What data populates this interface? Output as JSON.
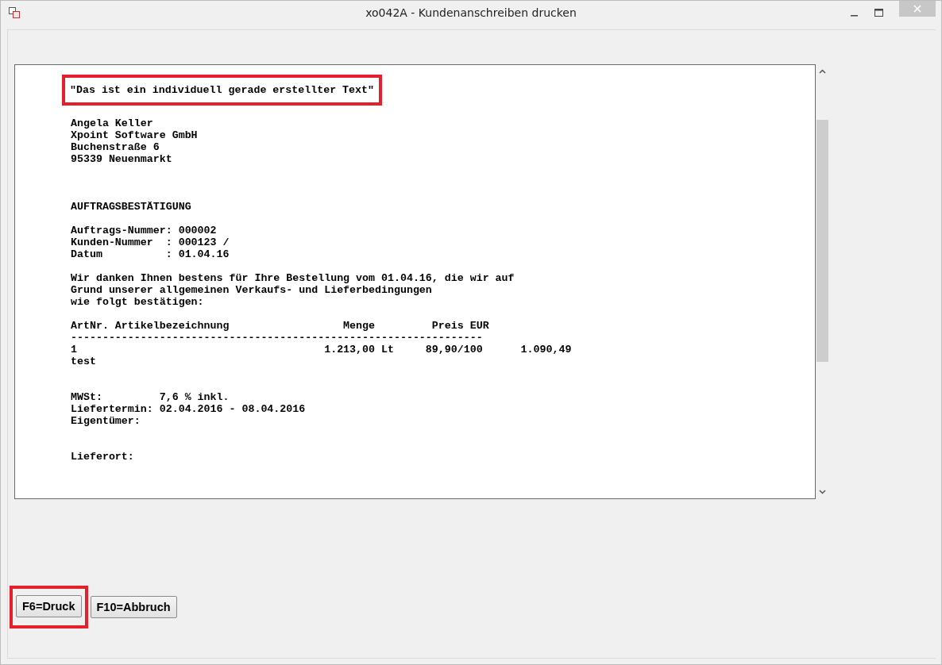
{
  "window": {
    "title": "xo042A - Kundenanschreiben drucken"
  },
  "document": {
    "blocks": [
      {
        "kind": "note",
        "highlighted": true,
        "lines": [
          "\"Das ist ein individuell gerade erstellter Text\""
        ]
      },
      {
        "kind": "address",
        "highlighted": false,
        "lines": [
          "Angela Keller",
          "Xpoint Software GmbH",
          "Buchenstraße 6",
          "95339 Neuenmarkt"
        ]
      },
      {
        "kind": "heading",
        "highlighted": false,
        "lines": [
          "AUFTRAGSBESTÄTIGUNG"
        ]
      },
      {
        "kind": "paragraph",
        "highlighted": false,
        "lines": [
          "Auftrags-Nummer: 000002",
          "Kunden-Nummer  : 000123 /",
          "Datum          : 01.04.16"
        ]
      },
      {
        "kind": "paragraph",
        "highlighted": false,
        "lines": [
          "Wir danken Ihnen bestens für Ihre Bestellung vom 01.04.16, die wir auf",
          "Grund unserer allgemeinen Verkaufs- und Lieferbedingungen",
          "wie folgt bestätigen:"
        ]
      },
      {
        "kind": "paragraph",
        "highlighted": false,
        "lines": [
          "ArtNr. Artikelbezeichnung                  Menge         Preis EUR",
          "-----------------------------------------------------------------",
          "1                                       1.213,00 Lt     89,90/100      1.090,49",
          "test"
        ]
      },
      {
        "kind": "section",
        "highlighted": false,
        "lines": [
          "MWSt:         7,6 % inkl.",
          "Liefertermin: 02.04.2016 - 08.04.2016",
          "Eigentümer:"
        ]
      },
      {
        "kind": "section",
        "highlighted": false,
        "lines": [
          "Lieferort:"
        ]
      }
    ]
  },
  "buttons": [
    {
      "label": "F6=Druck",
      "highlighted": true
    },
    {
      "label": "F10=Abbruch",
      "highlighted": false
    }
  ]
}
